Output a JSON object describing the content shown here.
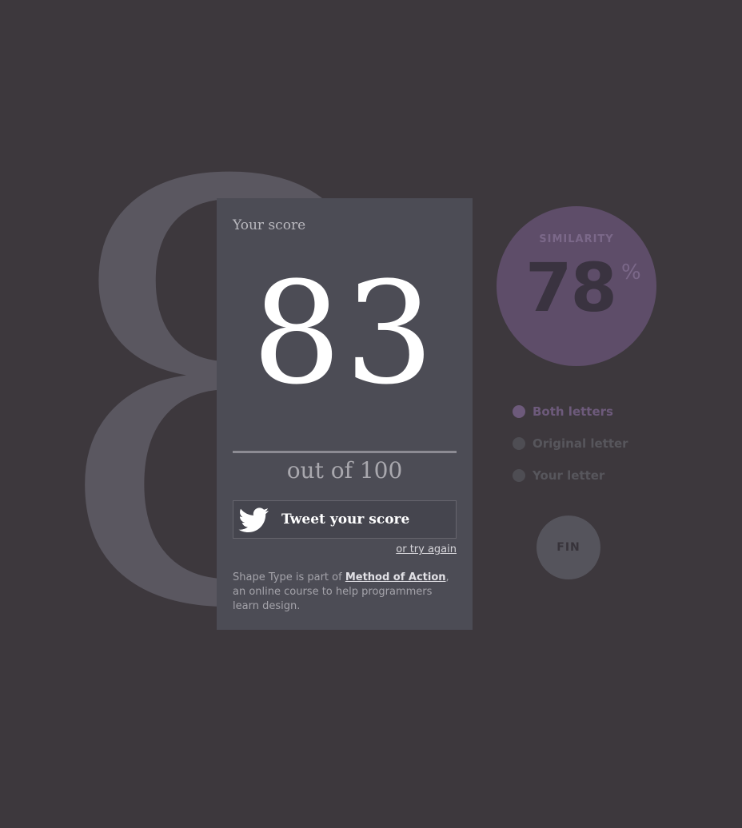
{
  "background_letter": "8",
  "score_card": {
    "title": "Your score",
    "score": "83",
    "out_of": "out of 100",
    "tweet_label": "Tweet your score",
    "try_again": "or try again",
    "blurb_before": "Shape Type is part of ",
    "blurb_link": "Method of Action",
    "blurb_after": ", an online course to help programmers learn design."
  },
  "similarity": {
    "label": "SIMILARITY",
    "value": "78",
    "unit": "%"
  },
  "legend": {
    "items": [
      {
        "label": "Both letters",
        "color": "#6d5a7b",
        "dot_color": "#6d5a7b"
      },
      {
        "label": "Original letter",
        "color": "#57565c",
        "dot_color": "#4e4d53"
      },
      {
        "label": "Your letter",
        "color": "#57565c",
        "dot_color": "#4e4d53"
      }
    ]
  },
  "fin_button": {
    "label": "FIN"
  },
  "colors": {
    "background": "#3d383d",
    "card": "#4c4c55",
    "similarity_circle": "#5e4d69",
    "accent_purple": "#6d5a7b"
  },
  "icons": {
    "tweet": "twitter-bird-icon"
  }
}
